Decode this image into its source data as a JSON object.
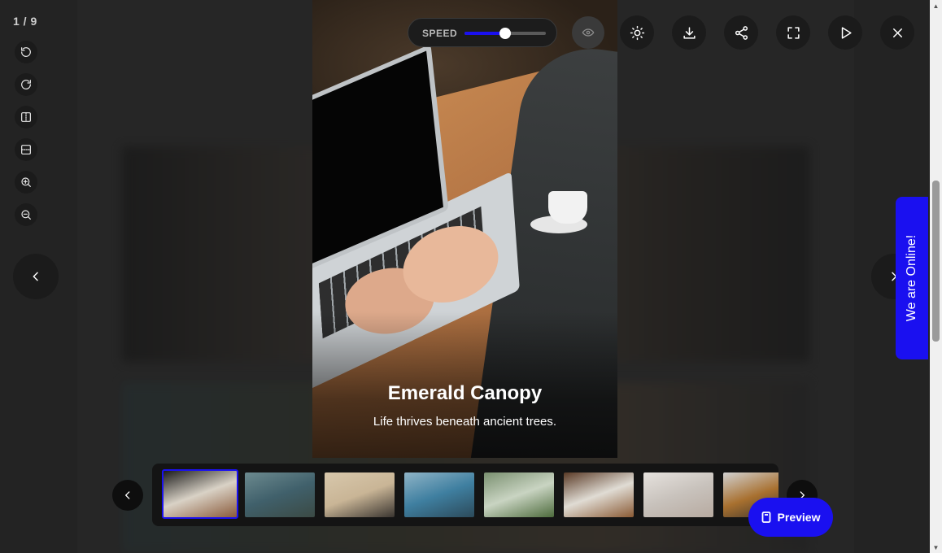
{
  "viewer": {
    "counter": "1 / 9",
    "speed_label": "SPEED",
    "speed_value": 0.5
  },
  "slide": {
    "title": "Emerald Canopy",
    "subtitle": "Life thrives beneath ancient trees."
  },
  "side_tools": [
    {
      "name": "rotate-left-icon"
    },
    {
      "name": "rotate-right-icon"
    },
    {
      "name": "flip-horizontal-icon"
    },
    {
      "name": "flip-vertical-icon"
    },
    {
      "name": "zoom-in-icon"
    },
    {
      "name": "zoom-out-icon"
    }
  ],
  "top_actions": [
    {
      "name": "eye-icon"
    },
    {
      "name": "brightness-icon"
    },
    {
      "name": "download-icon"
    },
    {
      "name": "share-icon"
    },
    {
      "name": "fullscreen-icon"
    },
    {
      "name": "play-icon"
    },
    {
      "name": "close-icon"
    }
  ],
  "thumbnails": [
    {
      "colors": [
        "#1b1b1b",
        "#d9d2c6",
        "#8a5a3a"
      ],
      "active": true
    },
    {
      "colors": [
        "#6c8a8f",
        "#40606b",
        "#3b4a44"
      ]
    },
    {
      "colors": [
        "#d8c8ac",
        "#c9b596",
        "#3a3530"
      ]
    },
    {
      "colors": [
        "#8fb4c7",
        "#3f7fa0",
        "#2c4a5a"
      ]
    },
    {
      "colors": [
        "#7a9070",
        "#c9d4c2",
        "#4d6b3c"
      ]
    },
    {
      "colors": [
        "#5a3a26",
        "#e0dcd4",
        "#8a5a34"
      ]
    },
    {
      "colors": [
        "#e6e2de",
        "#c8c2bc",
        "#b7aaa0"
      ]
    },
    {
      "colors": [
        "#d1d1d1",
        "#a8702f",
        "#2d2d2d"
      ]
    }
  ],
  "preview": {
    "label": "Preview"
  },
  "chat_tab": {
    "label": "We are Online!"
  },
  "colors": {
    "accent": "#1a10f0",
    "panel": "#1b1b1b"
  }
}
